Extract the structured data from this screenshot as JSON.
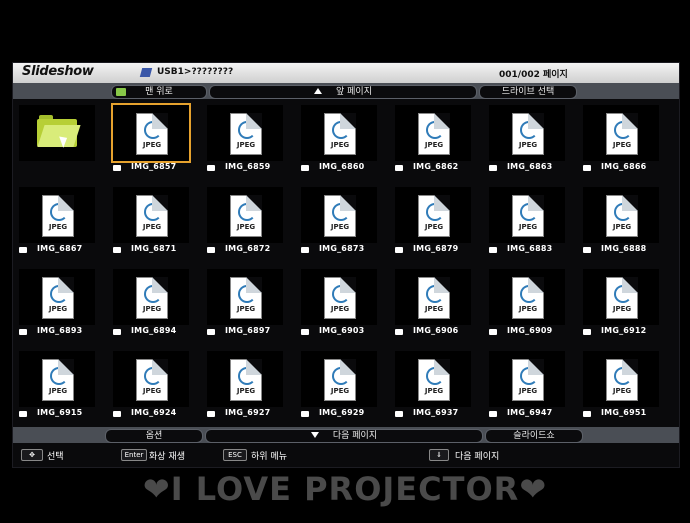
{
  "window": {
    "title": "Slideshow",
    "path": "USB1>????????",
    "page_indicator": "001/002 페이지"
  },
  "navbar": {
    "home_label": "맨 위로",
    "prev_page_label": "앞 페이지",
    "drive_select_label": "드라이브 선택"
  },
  "grid": {
    "folder_icon": "folder-up-icon",
    "files": [
      "IMG_6857",
      "IMG_6859",
      "IMG_6860",
      "IMG_6862",
      "IMG_6863",
      "IMG_6866",
      "IMG_6867",
      "IMG_6871",
      "IMG_6872",
      "IMG_6873",
      "IMG_6879",
      "IMG_6883",
      "IMG_6888",
      "IMG_6893",
      "IMG_6894",
      "IMG_6897",
      "IMG_6903",
      "IMG_6906",
      "IMG_6909",
      "IMG_6912",
      "IMG_6915",
      "IMG_6924",
      "IMG_6927",
      "IMG_6929",
      "IMG_6937",
      "IMG_6947",
      "IMG_6951"
    ],
    "thumb_label": "JPEG",
    "selected_index": 0
  },
  "bottombar": {
    "options_label": "옵션",
    "next_page_label": "다음 페이지",
    "slideshow_label": "슬라이드쇼"
  },
  "help": {
    "select_label": "선택",
    "enter_key": "Enter",
    "enter_label": "화상 재생",
    "esc_key": "ESC",
    "esc_label": "하위 메뉴",
    "next_label": "다음 페이지"
  },
  "banner": {
    "text": "❤I LOVE PROJECTOR❤"
  },
  "colors": {
    "selection": "#e6a22e",
    "bar": "#4a4e55",
    "background": "#000000"
  }
}
